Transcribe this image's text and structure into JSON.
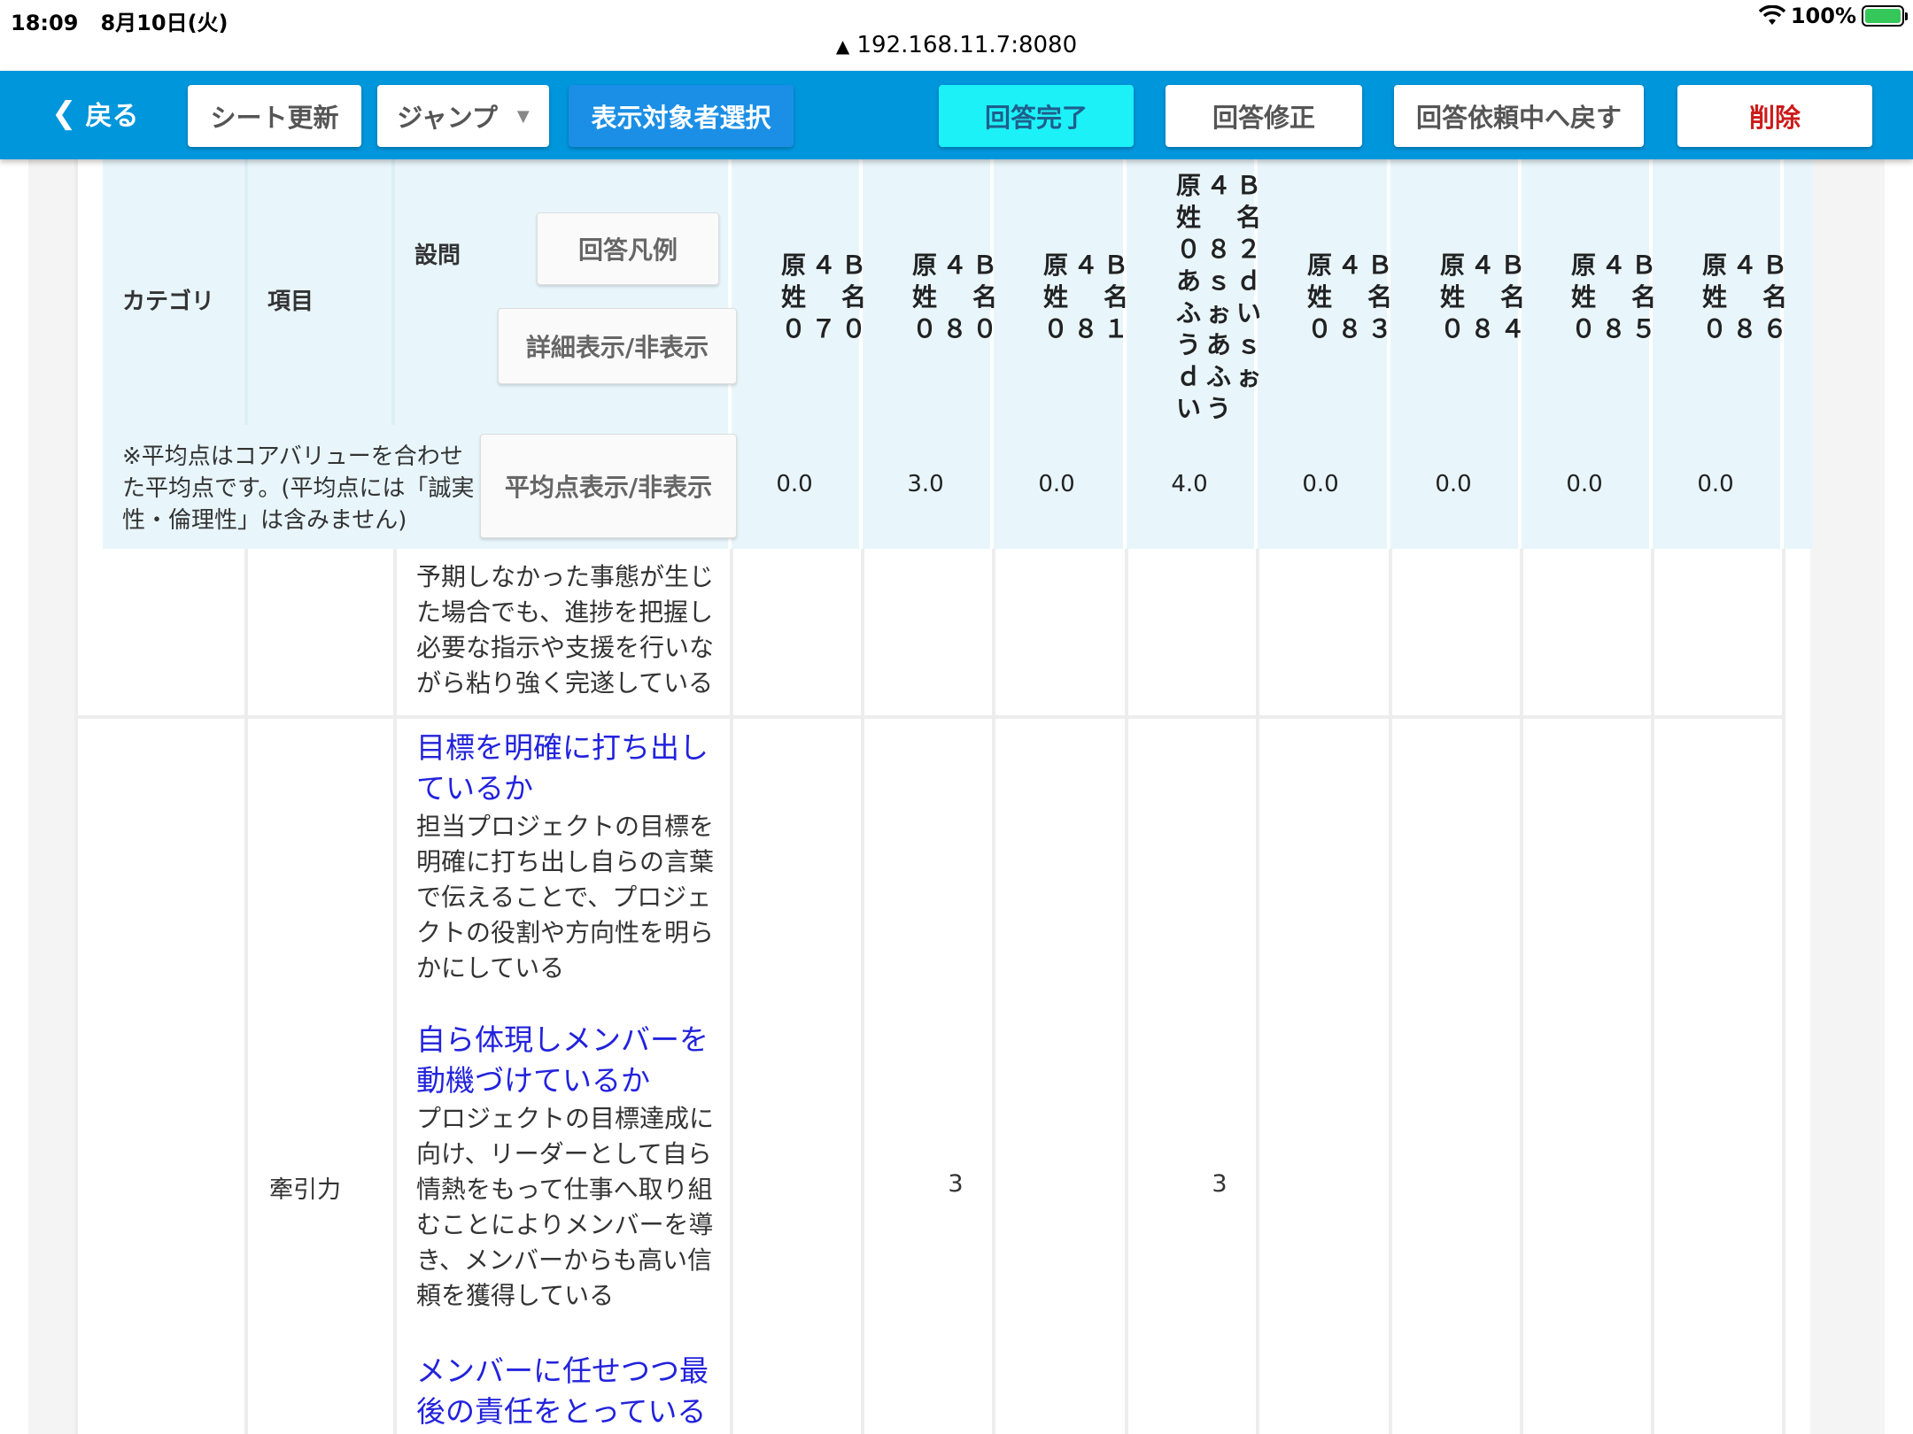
{
  "status_bar": {
    "time": "18:09",
    "date": "8月10日(火)",
    "url": "192.168.11.7:8080",
    "battery": "100%"
  },
  "toolbar": {
    "back": "戻る",
    "sheet_update": "シート更新",
    "jump": "ジャンプ",
    "select_targets": "表示対象者選択",
    "answer_complete": "回答完了",
    "answer_modify": "回答修正",
    "return_request": "回答依頼中へ戻す",
    "delete": "削除"
  },
  "header": {
    "category": "カテゴリ",
    "item": "項目",
    "question": "設問",
    "legend_button": "回答凡例",
    "detail_toggle": "詳細表示/非表示",
    "avg_note": "※平均点はコアバリューを合わせた平均点です。(平均点には「誠実性・倫理性」は含みません)",
    "avg_toggle": "平均点表示/非表示",
    "persons": [
      {
        "lines": [
          "原４Ｂ",
          "姓　名",
          "０７０"
        ],
        "avg": "0.0"
      },
      {
        "lines": [
          "原４Ｂ",
          "姓　名",
          "０８０"
        ],
        "avg": "3.0"
      },
      {
        "lines": [
          "原４Ｂ",
          "姓　名",
          "０８１"
        ],
        "avg": "0.0"
      },
      {
        "lines": [
          "原４Ｂ",
          "姓　名",
          "０８２",
          "あｓｄ",
          "ふぉい",
          "うあｓ",
          "ｄふぉ",
          "いう"
        ],
        "avg": "4.0"
      },
      {
        "lines": [
          "原４Ｂ",
          "姓　名",
          "０８３"
        ],
        "avg": "0.0"
      },
      {
        "lines": [
          "原４Ｂ",
          "姓　名",
          "０８４"
        ],
        "avg": "0.0"
      },
      {
        "lines": [
          "原４Ｂ",
          "姓　名",
          "０８５"
        ],
        "avg": "0.0"
      },
      {
        "lines": [
          "原４Ｂ",
          "姓　名",
          "０８６"
        ],
        "avg": "0.0"
      }
    ]
  },
  "rows": {
    "prev_question_text": "予期しなかった事態が生じた場合でも、進捗を把握し必要な指示や支援を行いながら粘り強く完遂している",
    "leadership": {
      "item": "牽引力",
      "questions": [
        {
          "title": "目標を明確に打ち出しているか",
          "text": "担当プロジェクトの目標を明確に打ち出し自らの言葉で伝えることで、プロジェクトの役割や方向性を明らかにしている"
        },
        {
          "title": "自ら体現しメンバーを動機づけているか",
          "text": "プロジェクトの目標達成に向け、リーダーとして自ら情熱をもって仕事へ取り組むことによりメンバーを導き、メンバーからも高い信頼を獲得している"
        },
        {
          "title": "メンバーに任せつつ最後の責任をとっている",
          "text": ""
        }
      ],
      "scores": [
        "",
        "3",
        "",
        "3",
        "",
        "",
        "",
        ""
      ]
    }
  }
}
